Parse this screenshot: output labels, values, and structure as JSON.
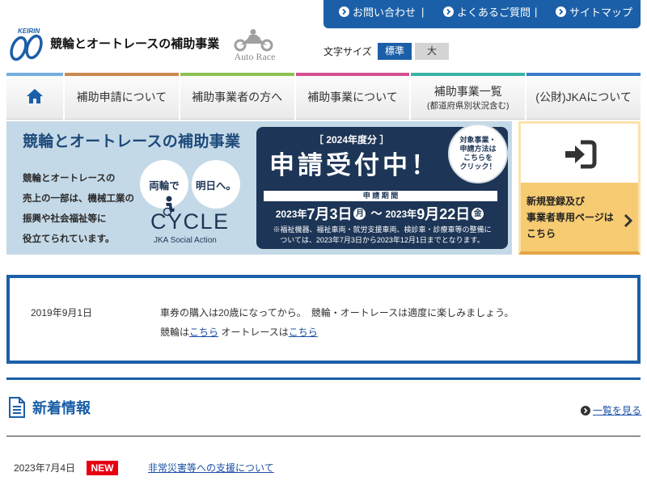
{
  "colors": {
    "brand_blue": "#1b5fa8",
    "banner_title": "#1d4a7a",
    "navy": "#1d3556",
    "banner_bg": "#c4d9e7",
    "login_gold": "#f6cb72",
    "new_badge": "#e60012",
    "link": "#1a4fa5"
  },
  "header": {
    "logo": {
      "text": "KEIRIN",
      "icon": "keirin-logo"
    },
    "site_title": "競輪とオートレースの補助事業",
    "autorace_logo": {
      "text": "Auto Race",
      "icon": "motorcycle-icon"
    },
    "utility_links": [
      {
        "label": "お問い合わせ",
        "icon": "circle-chevron-right-icon"
      },
      {
        "label": "よくあるご質問",
        "icon": "circle-chevron-right-icon"
      },
      {
        "label": "サイトマップ",
        "icon": "circle-chevron-right-icon"
      }
    ],
    "utility_separator": "|",
    "font_size": {
      "label": "文字サイズ",
      "options": [
        {
          "label": "標準",
          "selected": true
        },
        {
          "label": "大",
          "selected": false
        }
      ]
    }
  },
  "nav": {
    "home": {
      "icon": "home-icon",
      "accent": "#74aee0"
    },
    "items": [
      {
        "label": "補助申請について",
        "accent": "#c98a52"
      },
      {
        "label": "補助事業者の方へ",
        "accent": "#8cc152"
      },
      {
        "label": "補助事業について",
        "accent": "#d5508f"
      },
      {
        "label": "補助事業一覧",
        "sub": "(都道府県別状況含む)",
        "accent": "#3ab3a4"
      },
      {
        "label": "(公財)JKAについて",
        "accent": "#3d7cc9"
      }
    ]
  },
  "banner": {
    "title": "競輪とオートレースの補助事業",
    "body_lines": [
      "競輪とオートレースの",
      "売上の一部は、機械工業の",
      "振興や社会福祉等に",
      "役立てられています。"
    ],
    "circles": [
      "両輪で",
      "明日へ。"
    ],
    "cycle_logo": "CYCLE",
    "cycle_tagline": "JKA Social Action",
    "fiscal_year": "［ 2024年度分 ］",
    "headline": "申請受付中！",
    "badge_lines": [
      "対象事業・",
      "申請方法は",
      "こちらを",
      "クリック！"
    ],
    "period_label": "申 請 期 間",
    "period": {
      "start_year": "2023年",
      "start_md": "7月3日",
      "start_weekday": "月",
      "tilde": "～",
      "end_year": "2023年",
      "end_md": "9月22日",
      "end_weekday": "金"
    },
    "note_lines": [
      "※福祉機器、福祉車両・就労支援車両、検診車・診療車等の整備に",
      "ついては、2023年7月3日から2023年12月1日までとなります。"
    ]
  },
  "login_box": {
    "icon": "login-icon",
    "lines": [
      "新規登録及び",
      "事業者専用ページは",
      "こちら"
    ],
    "arrow_icon": "chevron-right-icon"
  },
  "notice": {
    "date": "2019年9月1日",
    "text": "車券の購入は20歳になってから。　競輪・オートレースは適度に楽しみましょう。",
    "keirin_prefix": "競輪は",
    "keirin_link": "こちら",
    "autorace_prefix": " オートレースは",
    "autorace_link": "こちら"
  },
  "news": {
    "icon": "document-icon",
    "heading": "新着情報",
    "view_all": "一覧を見る",
    "items": [
      {
        "date": "2023年7月4日",
        "badge": "NEW",
        "title": "非常災害等への支援について"
      }
    ]
  }
}
